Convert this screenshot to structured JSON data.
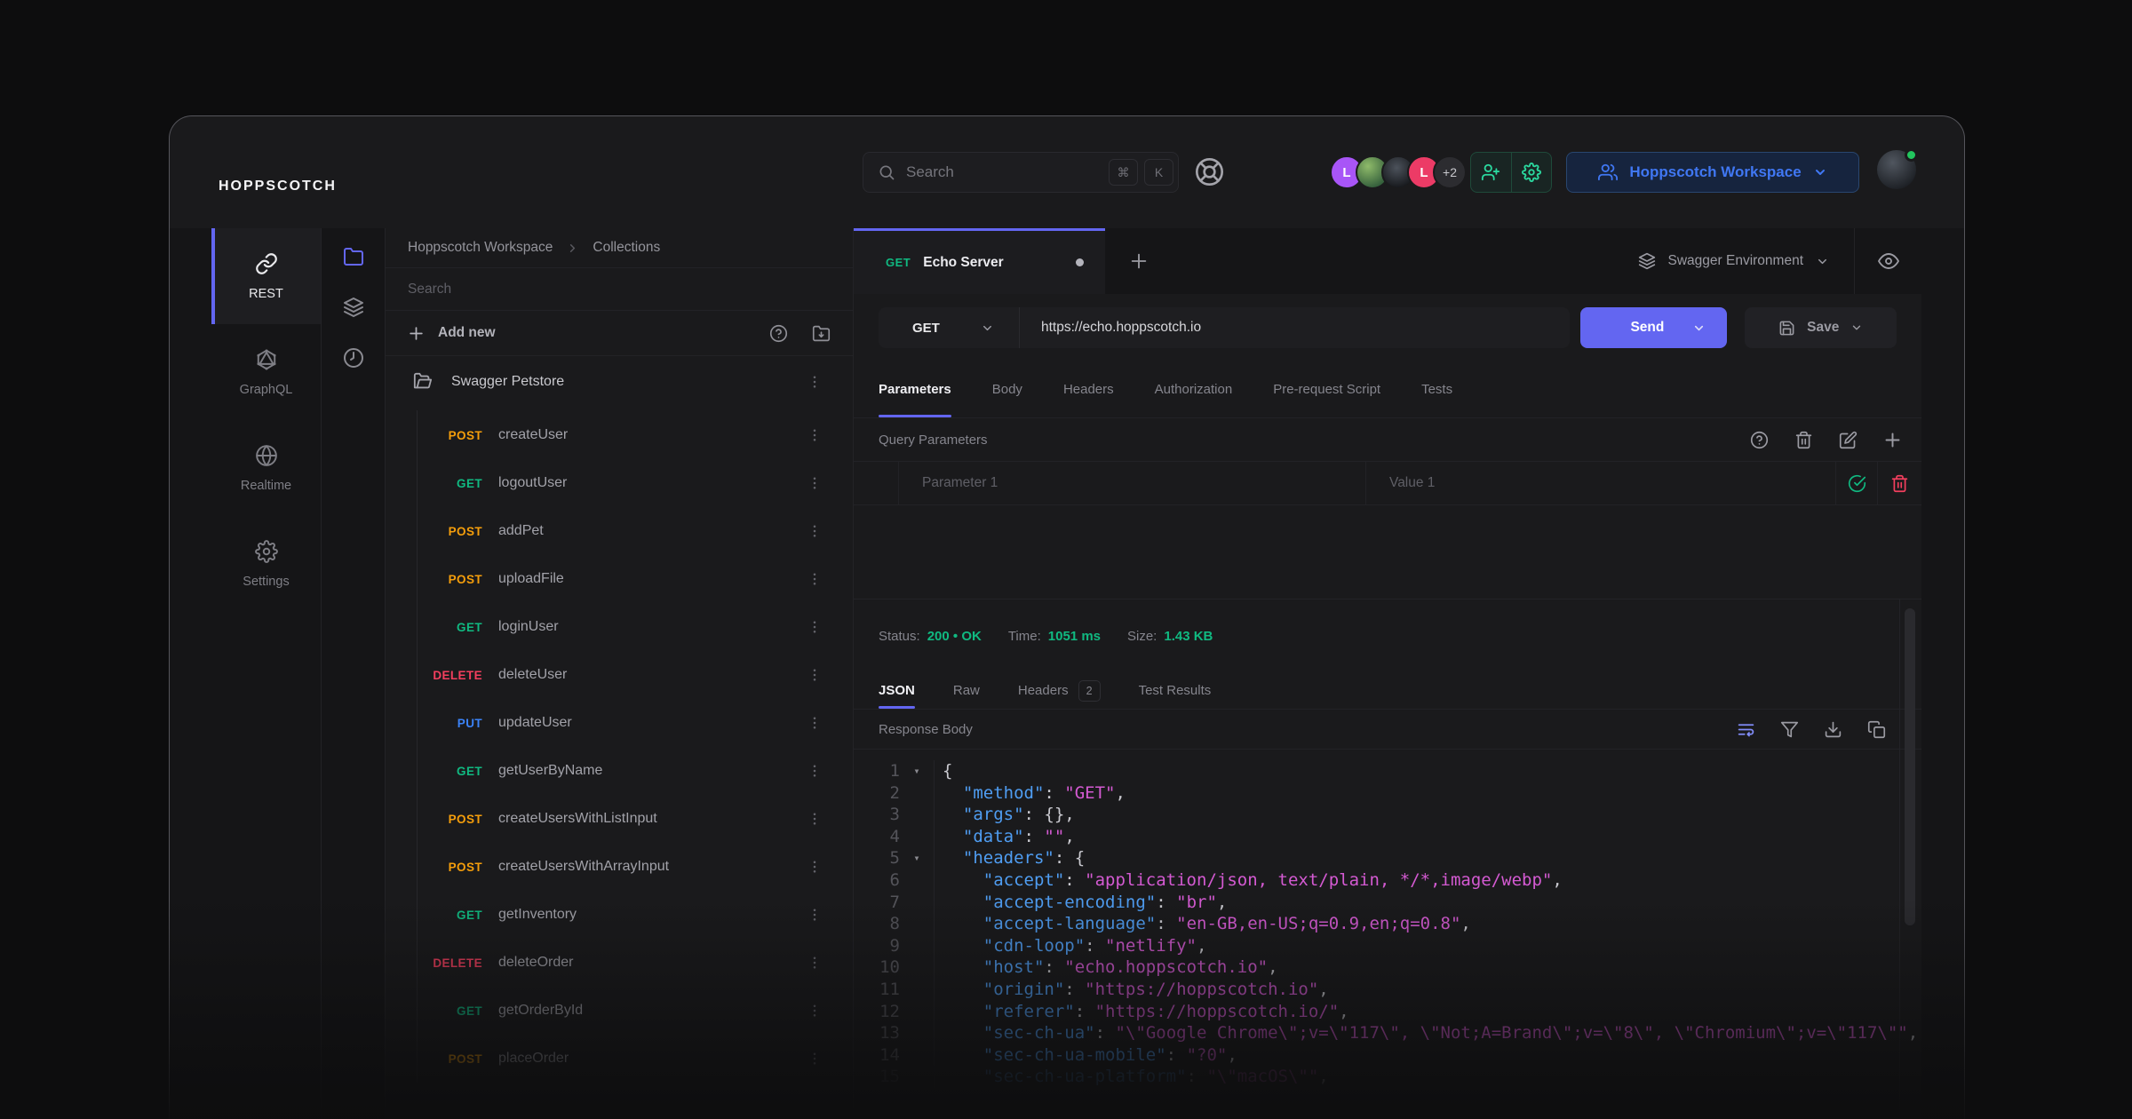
{
  "topbar": {
    "logo": "HOPPSCOTCH",
    "search_placeholder": "Search",
    "shortcut_mod": "⌘",
    "shortcut_key": "K",
    "avatars": [
      {
        "label": "L",
        "color": "#a855f7"
      },
      {
        "label": "",
        "type": "photo"
      },
      {
        "label": "",
        "type": "photo"
      },
      {
        "label": "L",
        "color": "#ec3b66"
      },
      {
        "label": "+2"
      }
    ],
    "workspace_button": "Hoppscotch Workspace"
  },
  "nav": {
    "rest": "REST",
    "graphql": "GraphQL",
    "realtime": "Realtime",
    "settings": "Settings"
  },
  "collections": {
    "breadcrumb": {
      "workspace": "Hoppscotch Workspace",
      "page": "Collections"
    },
    "search_placeholder": "Search",
    "add_new_label": "Add new",
    "folder_name": "Swagger Petstore",
    "requests": [
      {
        "method": "POST",
        "name": "createUser"
      },
      {
        "method": "GET",
        "name": "logoutUser"
      },
      {
        "method": "POST",
        "name": "addPet"
      },
      {
        "method": "POST",
        "name": "uploadFile"
      },
      {
        "method": "GET",
        "name": "loginUser"
      },
      {
        "method": "DELETE",
        "name": "deleteUser"
      },
      {
        "method": "PUT",
        "name": "updateUser"
      },
      {
        "method": "GET",
        "name": "getUserByName"
      },
      {
        "method": "POST",
        "name": "createUsersWithListInput"
      },
      {
        "method": "POST",
        "name": "createUsersWithArrayInput"
      },
      {
        "method": "GET",
        "name": "getInventory"
      },
      {
        "method": "DELETE",
        "name": "deleteOrder"
      },
      {
        "method": "GET",
        "name": "getOrderById"
      },
      {
        "method": "POST",
        "name": "placeOrder"
      }
    ]
  },
  "request": {
    "tab_method": "GET",
    "tab_name": "Echo Server",
    "environment": "Swagger Environment",
    "method": "GET",
    "url": "https://echo.hoppscotch.io",
    "send_label": "Send",
    "save_label": "Save",
    "tabs": [
      {
        "label": "Parameters",
        "active": true
      },
      {
        "label": "Body"
      },
      {
        "label": "Headers"
      },
      {
        "label": "Authorization"
      },
      {
        "label": "Pre-request Script"
      },
      {
        "label": "Tests"
      }
    ],
    "section_title": "Query Parameters",
    "param_placeholder": "Parameter 1",
    "value_placeholder": "Value 1"
  },
  "response": {
    "status_label": "Status:",
    "status_value": "200 • OK",
    "time_label": "Time:",
    "time_value": "1051 ms",
    "size_label": "Size:",
    "size_value": "1.43 KB",
    "tabs": [
      {
        "label": "JSON",
        "active": true
      },
      {
        "label": "Raw"
      },
      {
        "label": "Headers",
        "badge": "2"
      },
      {
        "label": "Test Results"
      }
    ],
    "body_label": "Response Body",
    "code": [
      {
        "num": "1",
        "fold": true,
        "indent": 0,
        "tokens": [
          [
            "p",
            "{"
          ]
        ]
      },
      {
        "num": "2",
        "indent": 1,
        "tokens": [
          [
            "k",
            "\"method\""
          ],
          [
            "p",
            ": "
          ],
          [
            "s",
            "\"GET\""
          ],
          [
            "p",
            ","
          ]
        ]
      },
      {
        "num": "3",
        "indent": 1,
        "tokens": [
          [
            "k",
            "\"args\""
          ],
          [
            "p",
            ": {},"
          ]
        ]
      },
      {
        "num": "4",
        "indent": 1,
        "tokens": [
          [
            "k",
            "\"data\""
          ],
          [
            "p",
            ": "
          ],
          [
            "s",
            "\"\""
          ],
          [
            "p",
            ","
          ]
        ]
      },
      {
        "num": "5",
        "fold": true,
        "indent": 1,
        "tokens": [
          [
            "k",
            "\"headers\""
          ],
          [
            "p",
            ": {"
          ]
        ]
      },
      {
        "num": "6",
        "indent": 2,
        "tokens": [
          [
            "k",
            "\"accept\""
          ],
          [
            "p",
            ": "
          ],
          [
            "s",
            "\"application/json, text/plain, */*,image/webp\""
          ],
          [
            "p",
            ","
          ]
        ]
      },
      {
        "num": "7",
        "indent": 2,
        "tokens": [
          [
            "k",
            "\"accept-encoding\""
          ],
          [
            "p",
            ": "
          ],
          [
            "s",
            "\"br\""
          ],
          [
            "p",
            ","
          ]
        ]
      },
      {
        "num": "8",
        "indent": 2,
        "tokens": [
          [
            "k",
            "\"accept-language\""
          ],
          [
            "p",
            ": "
          ],
          [
            "s",
            "\"en-GB,en-US;q=0.9,en;q=0.8\""
          ],
          [
            "p",
            ","
          ]
        ]
      },
      {
        "num": "9",
        "indent": 2,
        "tokens": [
          [
            "k",
            "\"cdn-loop\""
          ],
          [
            "p",
            ": "
          ],
          [
            "s",
            "\"netlify\""
          ],
          [
            "p",
            ","
          ]
        ]
      },
      {
        "num": "10",
        "indent": 2,
        "tokens": [
          [
            "k",
            "\"host\""
          ],
          [
            "p",
            ": "
          ],
          [
            "s",
            "\"echo.hoppscotch.io\""
          ],
          [
            "p",
            ","
          ]
        ]
      },
      {
        "num": "11",
        "indent": 2,
        "tokens": [
          [
            "k",
            "\"origin\""
          ],
          [
            "p",
            ": "
          ],
          [
            "s",
            "\"https://hoppscotch.io\""
          ],
          [
            "p",
            ","
          ]
        ]
      },
      {
        "num": "12",
        "indent": 2,
        "tokens": [
          [
            "k",
            "\"referer\""
          ],
          [
            "p",
            ": "
          ],
          [
            "s",
            "\"https://hoppscotch.io/\""
          ],
          [
            "p",
            ","
          ]
        ]
      },
      {
        "num": "13",
        "indent": 2,
        "tokens": [
          [
            "k",
            "\"sec-ch-ua\""
          ],
          [
            "p",
            ": "
          ],
          [
            "s",
            "\"\\\"Google Chrome\\\";v=\\\"117\\\", \\\"Not;A=Brand\\\";v=\\\"8\\\", \\\"Chromium\\\";v=\\\"117\\\"\""
          ],
          [
            "p",
            ","
          ]
        ]
      },
      {
        "num": "14",
        "indent": 2,
        "tokens": [
          [
            "k",
            "\"sec-ch-ua-mobile\""
          ],
          [
            "p",
            ": "
          ],
          [
            "s",
            "\"?0\""
          ],
          [
            "p",
            ","
          ]
        ]
      },
      {
        "num": "15",
        "indent": 2,
        "dim": 0.45,
        "tokens": [
          [
            "k",
            "\"sec-ch-ua-platform\""
          ],
          [
            "p",
            ": "
          ],
          [
            "s",
            "\"\\\"macOS\\\"\""
          ],
          [
            "p",
            ","
          ]
        ]
      }
    ]
  },
  "colors": {
    "accent": "#6366f1",
    "method_get": "#10b981",
    "method_post": "#f59e0b",
    "method_put": "#3b82f6",
    "method_delete": "#f43f5e",
    "status_green": "#10b981",
    "workspace_blue": "#4077f3",
    "json_key": "#4f9df2",
    "json_string": "#d45ad2"
  }
}
